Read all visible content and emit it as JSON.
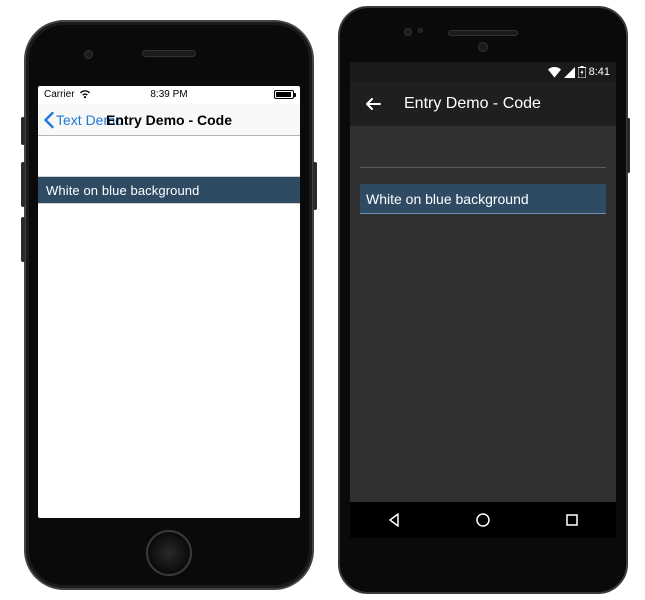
{
  "ios": {
    "status": {
      "carrier": "Carrier",
      "time": "8:39 PM"
    },
    "nav": {
      "back_label": "Text Demo",
      "title": "Entry Demo - Code"
    },
    "entry": {
      "value": "White on blue background"
    }
  },
  "android": {
    "status": {
      "time": "8:41"
    },
    "toolbar": {
      "title": "Entry Demo - Code"
    },
    "entries": {
      "empty_value": "",
      "filled_value": "White on blue background"
    }
  },
  "colors": {
    "entry_bg": "#2f4b64",
    "entry_text": "#ffffff",
    "ios_accent": "#1f79d8",
    "android_bg": "#303030"
  }
}
